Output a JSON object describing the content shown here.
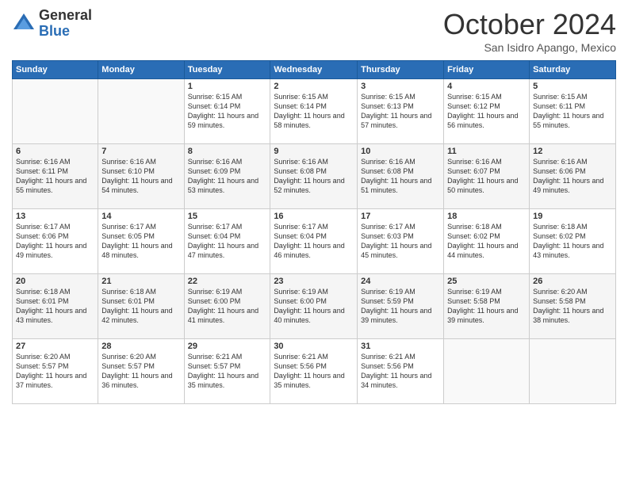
{
  "logo": {
    "general": "General",
    "blue": "Blue"
  },
  "header": {
    "month": "October 2024",
    "location": "San Isidro Apango, Mexico"
  },
  "weekdays": [
    "Sunday",
    "Monday",
    "Tuesday",
    "Wednesday",
    "Thursday",
    "Friday",
    "Saturday"
  ],
  "weeks": [
    [
      {
        "day": "",
        "sunrise": "",
        "sunset": "",
        "daylight": ""
      },
      {
        "day": "",
        "sunrise": "",
        "sunset": "",
        "daylight": ""
      },
      {
        "day": "1",
        "sunrise": "Sunrise: 6:15 AM",
        "sunset": "Sunset: 6:14 PM",
        "daylight": "Daylight: 11 hours and 59 minutes."
      },
      {
        "day": "2",
        "sunrise": "Sunrise: 6:15 AM",
        "sunset": "Sunset: 6:14 PM",
        "daylight": "Daylight: 11 hours and 58 minutes."
      },
      {
        "day": "3",
        "sunrise": "Sunrise: 6:15 AM",
        "sunset": "Sunset: 6:13 PM",
        "daylight": "Daylight: 11 hours and 57 minutes."
      },
      {
        "day": "4",
        "sunrise": "Sunrise: 6:15 AM",
        "sunset": "Sunset: 6:12 PM",
        "daylight": "Daylight: 11 hours and 56 minutes."
      },
      {
        "day": "5",
        "sunrise": "Sunrise: 6:15 AM",
        "sunset": "Sunset: 6:11 PM",
        "daylight": "Daylight: 11 hours and 55 minutes."
      }
    ],
    [
      {
        "day": "6",
        "sunrise": "Sunrise: 6:16 AM",
        "sunset": "Sunset: 6:11 PM",
        "daylight": "Daylight: 11 hours and 55 minutes."
      },
      {
        "day": "7",
        "sunrise": "Sunrise: 6:16 AM",
        "sunset": "Sunset: 6:10 PM",
        "daylight": "Daylight: 11 hours and 54 minutes."
      },
      {
        "day": "8",
        "sunrise": "Sunrise: 6:16 AM",
        "sunset": "Sunset: 6:09 PM",
        "daylight": "Daylight: 11 hours and 53 minutes."
      },
      {
        "day": "9",
        "sunrise": "Sunrise: 6:16 AM",
        "sunset": "Sunset: 6:08 PM",
        "daylight": "Daylight: 11 hours and 52 minutes."
      },
      {
        "day": "10",
        "sunrise": "Sunrise: 6:16 AM",
        "sunset": "Sunset: 6:08 PM",
        "daylight": "Daylight: 11 hours and 51 minutes."
      },
      {
        "day": "11",
        "sunrise": "Sunrise: 6:16 AM",
        "sunset": "Sunset: 6:07 PM",
        "daylight": "Daylight: 11 hours and 50 minutes."
      },
      {
        "day": "12",
        "sunrise": "Sunrise: 6:16 AM",
        "sunset": "Sunset: 6:06 PM",
        "daylight": "Daylight: 11 hours and 49 minutes."
      }
    ],
    [
      {
        "day": "13",
        "sunrise": "Sunrise: 6:17 AM",
        "sunset": "Sunset: 6:06 PM",
        "daylight": "Daylight: 11 hours and 49 minutes."
      },
      {
        "day": "14",
        "sunrise": "Sunrise: 6:17 AM",
        "sunset": "Sunset: 6:05 PM",
        "daylight": "Daylight: 11 hours and 48 minutes."
      },
      {
        "day": "15",
        "sunrise": "Sunrise: 6:17 AM",
        "sunset": "Sunset: 6:04 PM",
        "daylight": "Daylight: 11 hours and 47 minutes."
      },
      {
        "day": "16",
        "sunrise": "Sunrise: 6:17 AM",
        "sunset": "Sunset: 6:04 PM",
        "daylight": "Daylight: 11 hours and 46 minutes."
      },
      {
        "day": "17",
        "sunrise": "Sunrise: 6:17 AM",
        "sunset": "Sunset: 6:03 PM",
        "daylight": "Daylight: 11 hours and 45 minutes."
      },
      {
        "day": "18",
        "sunrise": "Sunrise: 6:18 AM",
        "sunset": "Sunset: 6:02 PM",
        "daylight": "Daylight: 11 hours and 44 minutes."
      },
      {
        "day": "19",
        "sunrise": "Sunrise: 6:18 AM",
        "sunset": "Sunset: 6:02 PM",
        "daylight": "Daylight: 11 hours and 43 minutes."
      }
    ],
    [
      {
        "day": "20",
        "sunrise": "Sunrise: 6:18 AM",
        "sunset": "Sunset: 6:01 PM",
        "daylight": "Daylight: 11 hours and 43 minutes."
      },
      {
        "day": "21",
        "sunrise": "Sunrise: 6:18 AM",
        "sunset": "Sunset: 6:01 PM",
        "daylight": "Daylight: 11 hours and 42 minutes."
      },
      {
        "day": "22",
        "sunrise": "Sunrise: 6:19 AM",
        "sunset": "Sunset: 6:00 PM",
        "daylight": "Daylight: 11 hours and 41 minutes."
      },
      {
        "day": "23",
        "sunrise": "Sunrise: 6:19 AM",
        "sunset": "Sunset: 6:00 PM",
        "daylight": "Daylight: 11 hours and 40 minutes."
      },
      {
        "day": "24",
        "sunrise": "Sunrise: 6:19 AM",
        "sunset": "Sunset: 5:59 PM",
        "daylight": "Daylight: 11 hours and 39 minutes."
      },
      {
        "day": "25",
        "sunrise": "Sunrise: 6:19 AM",
        "sunset": "Sunset: 5:58 PM",
        "daylight": "Daylight: 11 hours and 39 minutes."
      },
      {
        "day": "26",
        "sunrise": "Sunrise: 6:20 AM",
        "sunset": "Sunset: 5:58 PM",
        "daylight": "Daylight: 11 hours and 38 minutes."
      }
    ],
    [
      {
        "day": "27",
        "sunrise": "Sunrise: 6:20 AM",
        "sunset": "Sunset: 5:57 PM",
        "daylight": "Daylight: 11 hours and 37 minutes."
      },
      {
        "day": "28",
        "sunrise": "Sunrise: 6:20 AM",
        "sunset": "Sunset: 5:57 PM",
        "daylight": "Daylight: 11 hours and 36 minutes."
      },
      {
        "day": "29",
        "sunrise": "Sunrise: 6:21 AM",
        "sunset": "Sunset: 5:57 PM",
        "daylight": "Daylight: 11 hours and 35 minutes."
      },
      {
        "day": "30",
        "sunrise": "Sunrise: 6:21 AM",
        "sunset": "Sunset: 5:56 PM",
        "daylight": "Daylight: 11 hours and 35 minutes."
      },
      {
        "day": "31",
        "sunrise": "Sunrise: 6:21 AM",
        "sunset": "Sunset: 5:56 PM",
        "daylight": "Daylight: 11 hours and 34 minutes."
      },
      {
        "day": "",
        "sunrise": "",
        "sunset": "",
        "daylight": ""
      },
      {
        "day": "",
        "sunrise": "",
        "sunset": "",
        "daylight": ""
      }
    ]
  ]
}
